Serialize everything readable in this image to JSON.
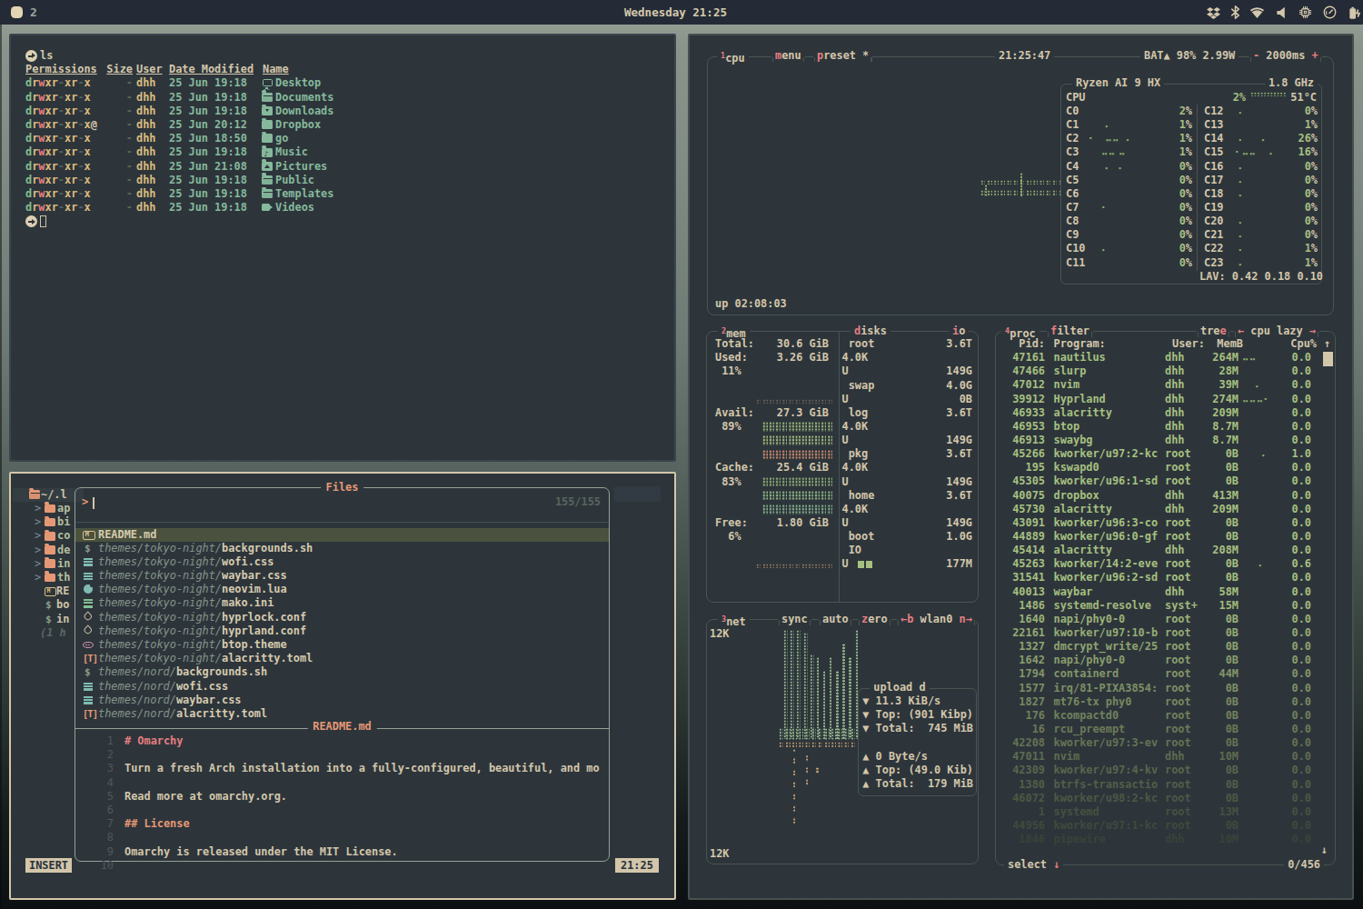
{
  "topbar": {
    "workspace": "2",
    "clock": "Wednesday 21:25",
    "tray_icons": [
      "dropbox",
      "bluetooth",
      "wifi",
      "volume",
      "cpu-chip",
      "gauge",
      "battery"
    ]
  },
  "terminal": {
    "prompt_command": "ls",
    "header": {
      "permissions": "Permissions",
      "size": "Size",
      "user": "User",
      "date": "Date Modified",
      "name": "Name"
    },
    "rows": [
      {
        "perm": "drwxr-xr-x",
        "size": "-",
        "user": "dhh",
        "date": "25 Jun 19:18",
        "icon": "monitor",
        "name": "Desktop"
      },
      {
        "perm": "drwxr-xr-x",
        "size": "-",
        "user": "dhh",
        "date": "25 Jun 19:18",
        "icon": "folder-open",
        "name": "Documents"
      },
      {
        "perm": "drwxr-xr-x",
        "size": "-",
        "user": "dhh",
        "date": "25 Jun 19:18",
        "icon": "folder-download",
        "name": "Downloads"
      },
      {
        "perm": "drwxr-xr-x@",
        "size": "-",
        "user": "dhh",
        "date": "25 Jun 20:12",
        "icon": "folder",
        "name": "Dropbox"
      },
      {
        "perm": "drwxr-xr-x",
        "size": "-",
        "user": "dhh",
        "date": "25 Jun 18:50",
        "icon": "folder",
        "name": "go"
      },
      {
        "perm": "drwxr-xr-x",
        "size": "-",
        "user": "dhh",
        "date": "25 Jun 19:18",
        "icon": "folder-music",
        "name": "Music"
      },
      {
        "perm": "drwxr-xr-x",
        "size": "-",
        "user": "dhh",
        "date": "25 Jun 21:08",
        "icon": "folder-image",
        "name": "Pictures"
      },
      {
        "perm": "drwxr-xr-x",
        "size": "-",
        "user": "dhh",
        "date": "25 Jun 19:18",
        "icon": "folder-open",
        "name": "Public"
      },
      {
        "perm": "drwxr-xr-x",
        "size": "-",
        "user": "dhh",
        "date": "25 Jun 19:18",
        "icon": "folder-open",
        "name": "Templates"
      },
      {
        "perm": "drwxr-xr-x",
        "size": "-",
        "user": "dhh",
        "date": "25 Jun 19:18",
        "icon": "video",
        "name": "Videos"
      }
    ]
  },
  "editor": {
    "tree": [
      {
        "level": "root",
        "icon": "folder-open",
        "label": "~/.l"
      },
      {
        "level": "dir",
        "chev": ">",
        "icon": "folder",
        "label": "ap"
      },
      {
        "level": "dir",
        "chev": ">",
        "icon": "folder",
        "label": "bi"
      },
      {
        "level": "dir",
        "chev": ">",
        "icon": "folder",
        "label": "co"
      },
      {
        "level": "dir",
        "chev": ">",
        "icon": "folder",
        "label": "de"
      },
      {
        "level": "dir",
        "chev": ">",
        "icon": "folder",
        "label": "in"
      },
      {
        "level": "dir",
        "chev": ">",
        "icon": "folder",
        "label": "th"
      },
      {
        "level": "file",
        "icon": "markdown",
        "label": "RE"
      },
      {
        "level": "shell",
        "icon": "shell",
        "label": "bo"
      },
      {
        "level": "shell",
        "icon": "shell",
        "label": "in"
      },
      {
        "level": "note",
        "label": "(1 h"
      }
    ],
    "picker": {
      "title": "Files",
      "prompt": ">",
      "count": "155/155",
      "items": [
        {
          "icon": "markdown",
          "dir": "",
          "name": "README.md",
          "state": "selected"
        },
        {
          "icon": "shell",
          "dir": "themes/tokyo-night/",
          "name": "backgrounds.sh"
        },
        {
          "icon": "css",
          "dir": "themes/tokyo-night/",
          "name": "wofi.css"
        },
        {
          "icon": "css",
          "dir": "themes/tokyo-night/",
          "name": "waybar.css"
        },
        {
          "icon": "lua",
          "dir": "themes/tokyo-night/",
          "name": "neovim.lua"
        },
        {
          "icon": "ini",
          "dir": "themes/tokyo-night/",
          "name": "mako.ini"
        },
        {
          "icon": "conf",
          "dir": "themes/tokyo-night/",
          "name": "hyprlock.conf"
        },
        {
          "icon": "conf",
          "dir": "themes/tokyo-night/",
          "name": "hyprland.conf"
        },
        {
          "icon": "theme",
          "dir": "themes/tokyo-night/",
          "name": "btop.theme"
        },
        {
          "icon": "toml",
          "dir": "themes/tokyo-night/",
          "name": "alacritty.toml"
        },
        {
          "icon": "shell",
          "dir": "themes/nord/",
          "name": "backgrounds.sh"
        },
        {
          "icon": "css",
          "dir": "themes/nord/",
          "name": "wofi.css"
        },
        {
          "icon": "css",
          "dir": "themes/nord/",
          "name": "waybar.css"
        },
        {
          "icon": "toml",
          "dir": "themes/nord/",
          "name": "alacritty.toml"
        }
      ],
      "preview": {
        "title": "README.md",
        "lines": [
          {
            "n": "1",
            "text": "# Omarchy",
            "level": "h1"
          },
          {
            "n": "2",
            "text": ""
          },
          {
            "n": "3",
            "text": "Turn a fresh Arch installation into a fully-configured, beautiful, and mo"
          },
          {
            "n": "4",
            "text": ""
          },
          {
            "n": "5",
            "text": "Read more at omarchy.org."
          },
          {
            "n": "6",
            "text": ""
          },
          {
            "n": "7",
            "text": "## License",
            "level": "h2"
          },
          {
            "n": "8",
            "text": ""
          },
          {
            "n": "9",
            "text": "Omarchy is released under the MIT License."
          },
          {
            "n": "10",
            "text": ""
          }
        ]
      }
    },
    "statusline": {
      "mode": "INSERT",
      "clock": "21:25"
    }
  },
  "btop": {
    "cpu": {
      "key": "1",
      "tab": "cpu",
      "menu_key": "m",
      "menu": "enu",
      "preset_key": "p",
      "preset": "reset *",
      "clock": "21:25:47",
      "battery": "BAT▲ 98% 2.99W",
      "interval_minus": "-",
      "interval": "2000ms",
      "interval_plus": "+",
      "model": "Ryzen AI 9 HX",
      "freq": "1.8 GHz",
      "total": {
        "label": "CPU",
        "pct": "2%",
        "temp": "51°C"
      },
      "cores_left": [
        {
          "n": "C0",
          "v": "2",
          "g": ""
        },
        {
          "n": "C1",
          "v": "1",
          "g": "     ⠄"
        },
        {
          "n": "C2",
          "v": "1",
          "g": "⠂   ⠤⠤  ⠄"
        },
        {
          "n": "C3",
          "v": "1",
          "g": "    ⠤⠤ ⠤"
        },
        {
          "n": "C4",
          "v": "0",
          "g": "     ⠄  ⠄"
        },
        {
          "n": "C5",
          "v": "0",
          "g": ""
        },
        {
          "n": "C6",
          "v": "0",
          "g": ""
        },
        {
          "n": "C7",
          "v": "0",
          "g": "    ⠂"
        },
        {
          "n": "C8",
          "v": "0",
          "g": ""
        },
        {
          "n": "C9",
          "v": "0",
          "g": ""
        },
        {
          "n": "C10",
          "v": "0",
          "g": "    ⠄"
        },
        {
          "n": "C11",
          "v": "0",
          "g": ""
        }
      ],
      "cores_right": [
        {
          "n": "C12",
          "v": "0",
          "g": "   ⠄"
        },
        {
          "n": "C13",
          "v": "1",
          "g": ""
        },
        {
          "n": "C14",
          "v": "26",
          "g": "   ⠄     ⠄"
        },
        {
          "n": "C15",
          "v": "16",
          "g": "  ⠂⠤⠤    ⠄"
        },
        {
          "n": "C16",
          "v": "0",
          "g": "   ⠄"
        },
        {
          "n": "C17",
          "v": "0",
          "g": "   ⠄"
        },
        {
          "n": "C18",
          "v": "0",
          "g": "   ⠄"
        },
        {
          "n": "C19",
          "v": "0",
          "g": ""
        },
        {
          "n": "C20",
          "v": "0",
          "g": "   ⠄"
        },
        {
          "n": "C21",
          "v": "0",
          "g": "   ⠄"
        },
        {
          "n": "C22",
          "v": "1",
          "g": "   ⠄"
        },
        {
          "n": "C23",
          "v": "1",
          "g": "   ⠄"
        }
      ],
      "lav": "LAV: 0.42 0.18 0.10",
      "uptime": "up 02:08:03"
    },
    "mem": {
      "key": "2",
      "tab": "mem",
      "lines": [
        {
          "label": "Total:",
          "val": "30.6 GiB"
        },
        {
          "label": "Used:",
          "val": "3.26 GiB"
        },
        {
          "label": " 11%"
        },
        {},
        {
          "m": "dots",
          "mc": "#6e675a"
        },
        {
          "label": "Avail:",
          "val": "27.3 GiB"
        },
        {
          "label": " 89%",
          "m": "blocks",
          "mc": "#9cb87a"
        },
        {
          "m": "blocks",
          "mc": "#a7c080"
        },
        {
          "m": "blocks",
          "mc": "#cf8d6e"
        },
        {
          "label": "Cache:",
          "val": "25.4 GiB"
        },
        {
          "label": " 83%",
          "m": "blocks",
          "mc": "#8fb077"
        },
        {
          "m": "blocks",
          "mc": "#94ba88"
        },
        {
          "m": "blocks",
          "mc": "#86b28e"
        },
        {
          "label": "Free:",
          "val": "1.80 GiB"
        },
        {
          "label": "  6%"
        },
        {},
        {
          "m": "dots",
          "mc": "#9a7a5f"
        }
      ]
    },
    "disks": {
      "key": "d",
      "tab": "isks",
      "io": "io",
      "lines": [
        {
          "label": " root",
          "val": "3.6T"
        },
        {
          "label": "4.0K"
        },
        {
          "label": "U",
          "val": "149G"
        },
        {
          "label": " swap",
          "val": "4.0G"
        },
        {
          "label": "U",
          "val": "0B"
        },
        {
          "label": " log",
          "val": "3.6T"
        },
        {
          "label": "4.0K"
        },
        {
          "label": "U",
          "val": "149G"
        },
        {
          "label": " pkg",
          "val": "3.6T"
        },
        {
          "label": "4.0K"
        },
        {
          "label": "U",
          "val": "149G"
        },
        {
          "label": " home",
          "val": "3.6T"
        },
        {
          "label": "4.0K"
        },
        {
          "label": "U",
          "val": "149G"
        },
        {
          "label": " boot",
          "val": "1.0G"
        },
        {
          "label": " IO"
        },
        {
          "label": "U",
          "m": "blocks",
          "val": "177M"
        }
      ]
    },
    "net": {
      "key": "3",
      "tab": "net",
      "opt_sync": "sync",
      "opt_auto": "auto",
      "opt_zero_key": "z",
      "opt_zero": "ero",
      "prev": "←b",
      "iface": "wlan0",
      "next": "n→",
      "scale_top": "12K",
      "scale_bottom": "12K",
      "info": {
        "title": "upload d",
        "lines": [
          "▼ 11.3 KiB/s",
          "▼ Top: (901 Kibp)",
          "▼ Total:  745 MiB",
          "",
          "▲ 0 Byte/s",
          "▲ Top: (49.0 Kib)",
          "▲ Total:  179 MiB"
        ]
      }
    },
    "proc": {
      "key": "4",
      "tab": "proc",
      "filter_key": "f",
      "filter": "ilter",
      "tree": "tre",
      "tree_key": "e",
      "nav_prev": "←",
      "nav": "cpu lazy",
      "nav_next": "→",
      "header": {
        "pid": "Pid:",
        "program": "Program:",
        "user": "User:",
        "mem": "MemB",
        "cpu": "Cpu%",
        "sort": "↑"
      },
      "rows": [
        {
          "pid": "47161",
          "prog": "nautilus",
          "user": "dhh",
          "mem": "264M",
          "g": "⠤⠤",
          "cpu": "0.0",
          "c": "#a7c080"
        },
        {
          "pid": "47466",
          "prog": "slurp",
          "user": "dhh",
          "mem": "28M",
          "g": "",
          "cpu": "0.0",
          "c": "#a7c080"
        },
        {
          "pid": "47012",
          "prog": "nvim",
          "user": "dhh",
          "mem": "39M",
          "g": "    ⠄",
          "cpu": "0.0",
          "c": "#a7c080"
        },
        {
          "pid": "39912",
          "prog": "Hyprland",
          "user": "dhh",
          "mem": "274M",
          "g": "⠤⠤⠤⠂",
          "cpu": "0.0",
          "c": "#a7c080"
        },
        {
          "pid": "46933",
          "prog": "alacritty",
          "user": "dhh",
          "mem": "209M",
          "g": "",
          "cpu": "0.0",
          "c": "#a7c080"
        },
        {
          "pid": "46953",
          "prog": "btop",
          "user": "dhh",
          "mem": "8.7M",
          "g": "",
          "cpu": "0.0",
          "c": "#a7c080"
        },
        {
          "pid": "46913",
          "prog": "swaybg",
          "user": "dhh",
          "mem": "8.7M",
          "g": "",
          "cpu": "0.0",
          "c": "#a7c080"
        },
        {
          "pid": "45266",
          "prog": "kworker/u97:2-kc",
          "user": "root",
          "mem": "0B",
          "g": "      ⠄",
          "cpu": "1.0",
          "c": "#a7c080"
        },
        {
          "pid": "195",
          "prog": "kswapd0",
          "user": "root",
          "mem": "0B",
          "g": "",
          "cpu": "0.0",
          "c": "#a7c080"
        },
        {
          "pid": "45305",
          "prog": "kworker/u96:1-sd",
          "user": "root",
          "mem": "0B",
          "g": "",
          "cpu": "0.0",
          "c": "#a7c080"
        },
        {
          "pid": "40075",
          "prog": "dropbox",
          "user": "dhh",
          "mem": "413M",
          "g": "",
          "cpu": "0.0",
          "c": "#a7c080"
        },
        {
          "pid": "45730",
          "prog": "alacritty",
          "user": "dhh",
          "mem": "209M",
          "g": "",
          "cpu": "0.0",
          "c": "#a7c080"
        },
        {
          "pid": "43091",
          "prog": "kworker/u96:3-co",
          "user": "root",
          "mem": "0B",
          "g": "",
          "cpu": "0.0",
          "c": "#a7c080"
        },
        {
          "pid": "44889",
          "prog": "kworker/u96:0-gf",
          "user": "root",
          "mem": "0B",
          "g": "",
          "cpu": "0.0",
          "c": "#a7c080"
        },
        {
          "pid": "45414",
          "prog": "alacritty",
          "user": "dhh",
          "mem": "208M",
          "g": "",
          "cpu": "0.0",
          "c": "#a7c080"
        },
        {
          "pid": "45263",
          "prog": "kworker/14:2-eve",
          "user": "root",
          "mem": "0B",
          "g": "     ⠄",
          "cpu": "0.6",
          "c": "#a7c080"
        },
        {
          "pid": "31541",
          "prog": "kworker/u96:2-sd",
          "user": "root",
          "mem": "0B",
          "g": "",
          "cpu": "0.0",
          "c": "#a7c080"
        },
        {
          "pid": "40013",
          "prog": "waybar",
          "user": "dhh",
          "mem": "58M",
          "g": "",
          "cpu": "0.0",
          "c": "#a7c080"
        },
        {
          "pid": "1486",
          "prog": "systemd-resolve",
          "user": "syst+",
          "mem": "15M",
          "g": "",
          "cpu": "0.0",
          "c": "#a1b97c"
        },
        {
          "pid": "1640",
          "prog": "napi/phy0-0",
          "user": "root",
          "mem": "0B",
          "g": "",
          "cpu": "0.0",
          "c": "#9bb278"
        },
        {
          "pid": "22161",
          "prog": "kworker/u97:10-b",
          "user": "root",
          "mem": "0B",
          "g": "",
          "cpu": "0.0",
          "c": "#95ab74"
        },
        {
          "pid": "1327",
          "prog": "dmcrypt_write/25",
          "user": "root",
          "mem": "0B",
          "g": "",
          "cpu": "0.0",
          "c": "#8fa470"
        },
        {
          "pid": "1642",
          "prog": "napi/phy0-0",
          "user": "root",
          "mem": "0B",
          "g": "",
          "cpu": "0.0",
          "c": "#899d6c"
        },
        {
          "pid": "1794",
          "prog": "containerd",
          "user": "root",
          "mem": "44M",
          "g": "",
          "cpu": "0.0",
          "c": "#839668"
        },
        {
          "pid": "1577",
          "prog": "irq/81-PIXA3854:",
          "user": "root",
          "mem": "0B",
          "g": "",
          "cpu": "0.0",
          "c": "#7d8f64"
        },
        {
          "pid": "1827",
          "prog": "mt76-tx phy0",
          "user": "root",
          "mem": "0B",
          "g": "",
          "cpu": "0.0",
          "c": "#778860"
        },
        {
          "pid": "176",
          "prog": "kcompactd0",
          "user": "root",
          "mem": "0B",
          "g": "",
          "cpu": "0.0",
          "c": "#71815c"
        },
        {
          "pid": "16",
          "prog": "rcu_preempt",
          "user": "root",
          "mem": "0B",
          "g": "",
          "cpu": "0.0",
          "c": "#6b7a58"
        },
        {
          "pid": "42208",
          "prog": "kworker/u97:3-ev",
          "user": "root",
          "mem": "0B",
          "g": "",
          "cpu": "0.0",
          "c": "#657354"
        },
        {
          "pid": "47011",
          "prog": "nvim",
          "user": "dhh",
          "mem": "10M",
          "g": "",
          "cpu": "0.0",
          "c": "#5f6c50"
        },
        {
          "pid": "42309",
          "prog": "kworker/u97:4-kv",
          "user": "root",
          "mem": "0B",
          "g": "",
          "cpu": "0.0",
          "c": "#59654c"
        },
        {
          "pid": "1380",
          "prog": "btrfs-transactio",
          "user": "root",
          "mem": "0B",
          "g": "",
          "cpu": "0.0",
          "c": "#535e48"
        },
        {
          "pid": "46072",
          "prog": "kworker/u98:2-kc",
          "user": "root",
          "mem": "0B",
          "g": "",
          "cpu": "0.0",
          "c": "#4d5744"
        },
        {
          "pid": "1",
          "prog": "systemd",
          "user": "root",
          "mem": "13M",
          "g": "",
          "cpu": "0.0",
          "c": "#475040"
        },
        {
          "pid": "44956",
          "prog": "kworker/u97:1-kc",
          "user": "root",
          "mem": "0B",
          "g": "",
          "cpu": "0.0",
          "c": "#41493c"
        },
        {
          "pid": "1846",
          "prog": "pipewire",
          "user": "dhh",
          "mem": "10M",
          "g": "",
          "cpu": "0.0",
          "c": "#3b4238"
        }
      ],
      "footer": {
        "select": "select",
        "select_key": "↓",
        "count": "0/456",
        "scroll_down": "↓"
      }
    }
  }
}
